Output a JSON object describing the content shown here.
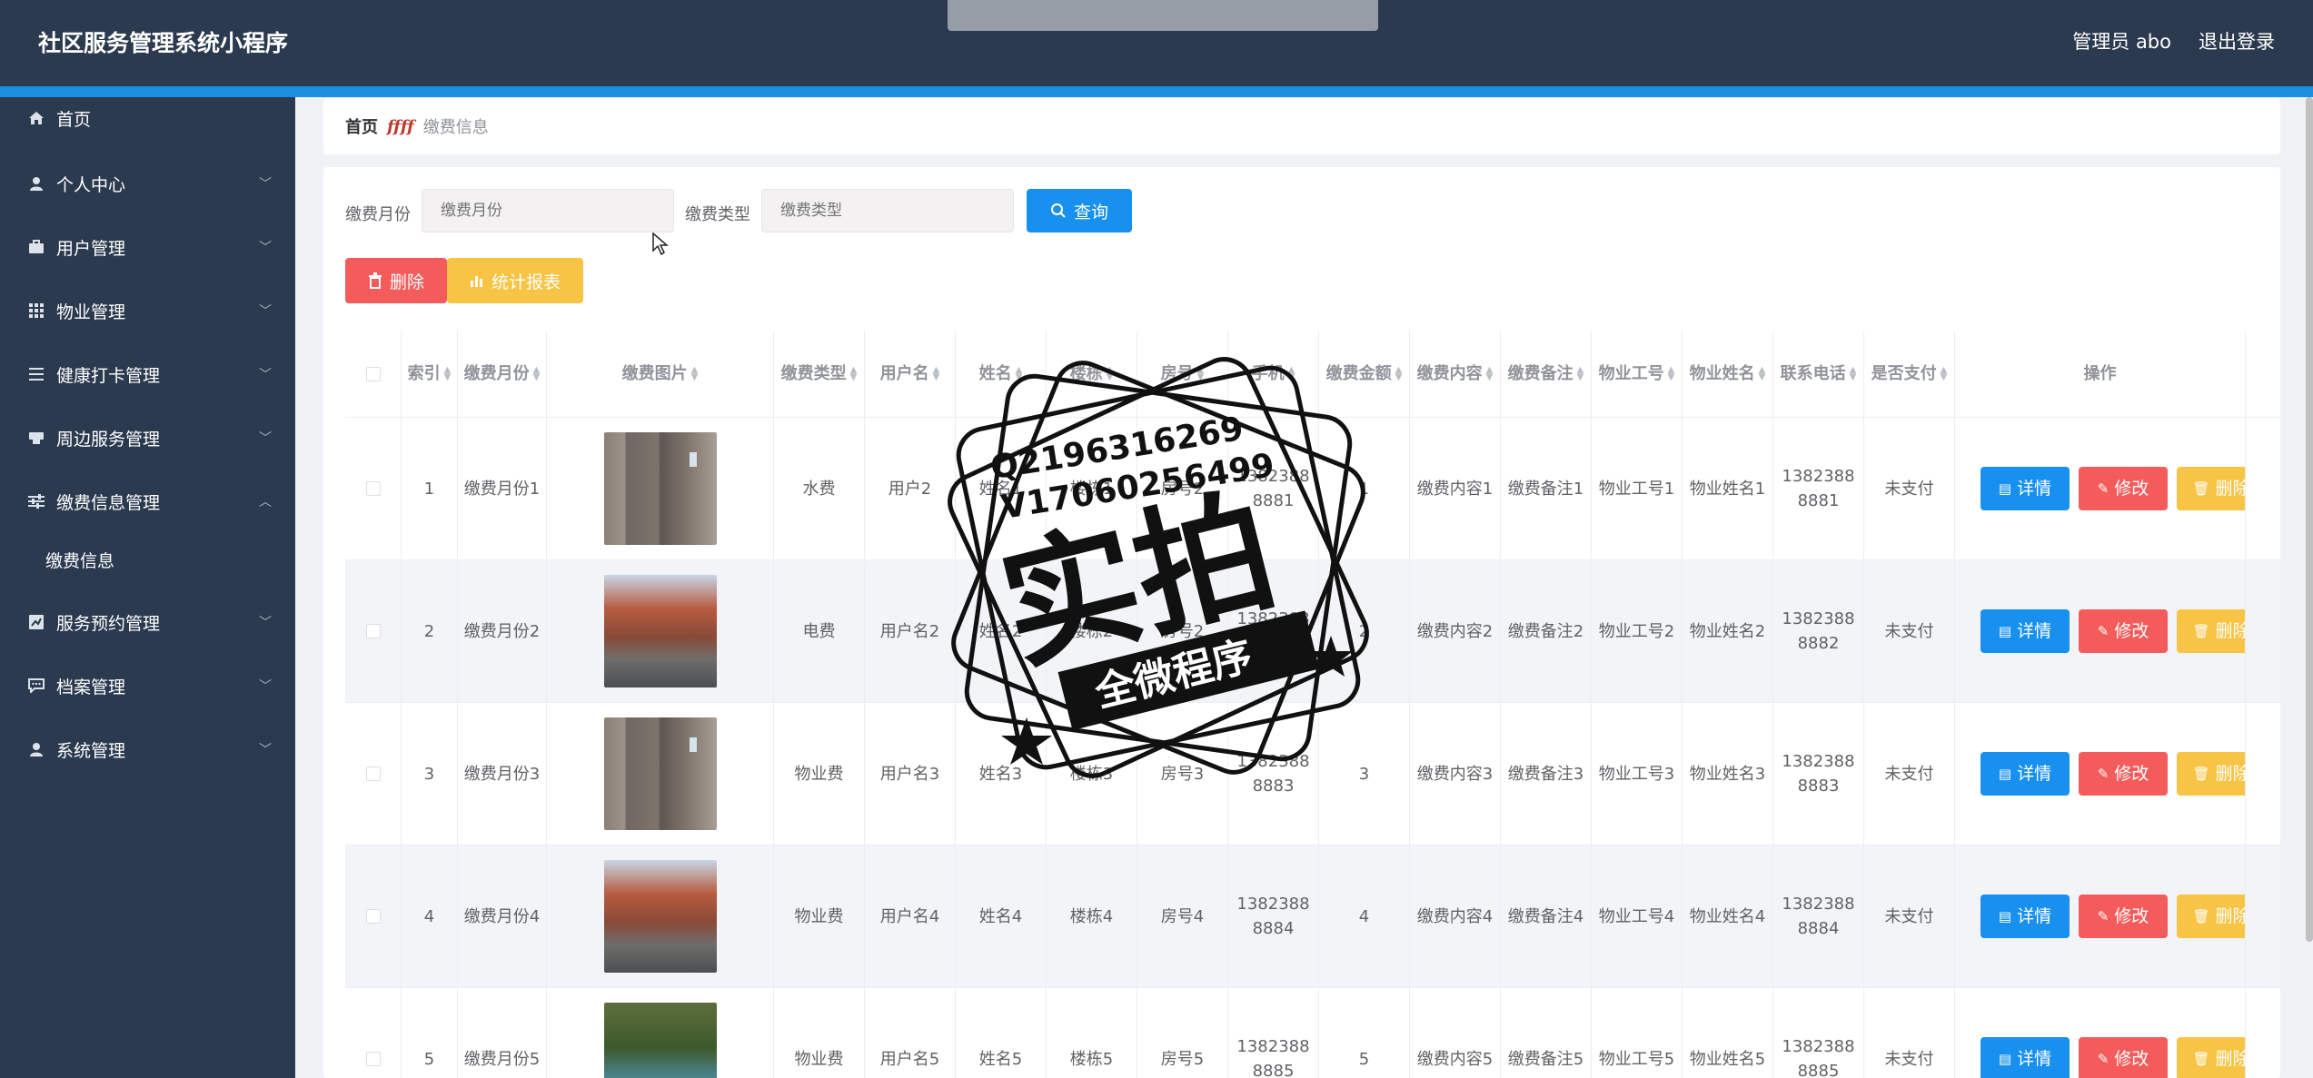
{
  "header": {
    "title": "社区服务管理系统小程序",
    "admin_label": "管理员 abo",
    "logout_label": "退出登录"
  },
  "sidebar": {
    "items": [
      {
        "label": "首页",
        "icon": "home-icon",
        "expanded": null
      },
      {
        "label": "个人中心",
        "icon": "user-icon",
        "expanded": false
      },
      {
        "label": "用户管理",
        "icon": "briefcase-icon",
        "expanded": false
      },
      {
        "label": "物业管理",
        "icon": "grid-icon",
        "expanded": false
      },
      {
        "label": "健康打卡管理",
        "icon": "list-icon",
        "expanded": false
      },
      {
        "label": "周边服务管理",
        "icon": "printer-icon",
        "expanded": false
      },
      {
        "label": "缴费信息管理",
        "icon": "sliders-icon",
        "expanded": true
      },
      {
        "label": "服务预约管理",
        "icon": "chart-box-icon",
        "expanded": false
      },
      {
        "label": "档案管理",
        "icon": "message-icon",
        "expanded": false
      },
      {
        "label": "系统管理",
        "icon": "user-icon",
        "expanded": false
      }
    ],
    "sub_item": "缴费信息"
  },
  "breadcrumb": {
    "home": "首页",
    "separator": "ffff",
    "current": "缴费信息"
  },
  "filters": {
    "month_label": "缴费月份",
    "month_placeholder": "缴费月份",
    "type_label": "缴费类型",
    "type_placeholder": "缴费类型",
    "query_button": "查询"
  },
  "actions": {
    "delete_button": "删除",
    "report_button": "统计报表"
  },
  "table": {
    "headers": [
      "索引",
      "缴费月份",
      "缴费图片",
      "缴费类型",
      "用户名",
      "姓名",
      "楼栋",
      "房号",
      "手机",
      "缴费金额",
      "缴费内容",
      "缴费备注",
      "物业工号",
      "物业姓名",
      "联系电话",
      "是否支付",
      "操作"
    ],
    "detail_label": "详情",
    "edit_label": "修改",
    "delete_label": "删除",
    "rows": [
      {
        "index": "1",
        "month": "缴费月份1",
        "image": "elevator",
        "type": "水费",
        "username": "用户2",
        "name": "姓名1",
        "building": "楼栋1",
        "room": "房号2",
        "phone": "13823888881",
        "amount": "1",
        "content": "缴费内容1",
        "remark": "缴费备注1",
        "staff_no": "物业工号1",
        "staff_name": "物业姓名1",
        "contact": "13823888881",
        "paid": "未支付"
      },
      {
        "index": "2",
        "month": "缴费月份2",
        "image": "street",
        "type": "电费",
        "username": "用户名2",
        "name": "姓名2",
        "building": "楼栋2",
        "room": "房号2",
        "phone": "13823888882",
        "amount": "2",
        "content": "缴费内容2",
        "remark": "缴费备注2",
        "staff_no": "物业工号2",
        "staff_name": "物业姓名2",
        "contact": "13823888882",
        "paid": "未支付"
      },
      {
        "index": "3",
        "month": "缴费月份3",
        "image": "elevator",
        "type": "物业费",
        "username": "用户名3",
        "name": "姓名3",
        "building": "楼栋3",
        "room": "房号3",
        "phone": "13823888883",
        "amount": "3",
        "content": "缴费内容3",
        "remark": "缴费备注3",
        "staff_no": "物业工号3",
        "staff_name": "物业姓名3",
        "contact": "13823888883",
        "paid": "未支付"
      },
      {
        "index": "4",
        "month": "缴费月份4",
        "image": "street",
        "type": "物业费",
        "username": "用户名4",
        "name": "姓名4",
        "building": "楼栋4",
        "room": "房号4",
        "phone": "13823888884",
        "amount": "4",
        "content": "缴费内容4",
        "remark": "缴费备注4",
        "staff_no": "物业工号4",
        "staff_name": "物业姓名4",
        "contact": "13823888884",
        "paid": "未支付"
      },
      {
        "index": "5",
        "month": "缴费月份5",
        "image": "park",
        "type": "物业费",
        "username": "用户名5",
        "name": "姓名5",
        "building": "楼栋5",
        "room": "房号5",
        "phone": "13823888885",
        "amount": "5",
        "content": "缴费内容5",
        "remark": "缴费备注5",
        "staff_no": "物业工号5",
        "staff_name": "物业姓名5",
        "contact": "13823888885",
        "paid": "未支付"
      }
    ]
  },
  "watermark": {
    "line1": "Q2196316269",
    "line2": "V17060256499",
    "big": "实拍",
    "banner": "全微程序"
  },
  "colors": {
    "header_bg": "#2c3a4f",
    "accent_bar": "#1a8fe0",
    "primary": "#1890f0",
    "danger": "#f45c5c",
    "warning": "#f8c445"
  }
}
